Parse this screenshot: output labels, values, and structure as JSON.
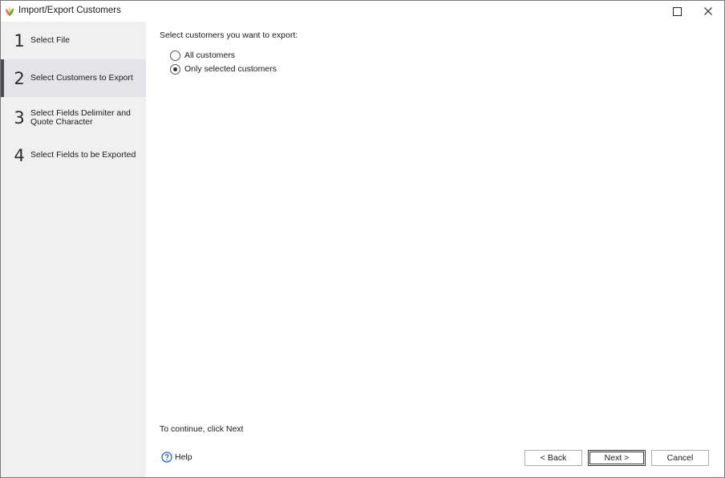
{
  "window": {
    "title": "Import/Export Customers",
    "maximize_icon": "maximize-icon",
    "close_icon": "close-icon"
  },
  "steps": [
    {
      "number": "1",
      "label": "Select File",
      "active": false
    },
    {
      "number": "2",
      "label": "Select Customers to Export",
      "active": true
    },
    {
      "number": "3",
      "label": "Select Fields Delimiter and Quote Character",
      "active": false
    },
    {
      "number": "4",
      "label": "Select Fields to be Exported",
      "active": false
    }
  ],
  "content": {
    "prompt": "Select customers you want to export:",
    "options": [
      {
        "label": "All customers",
        "checked": false
      },
      {
        "label": "Only selected customers",
        "checked": true
      }
    ],
    "continue_text": "To continue, click Next"
  },
  "footer": {
    "help_label": "Help",
    "back_label": "< Back",
    "next_label": "Next >",
    "cancel_label": "Cancel"
  },
  "colors": {
    "sidebar_bg": "#f0f0f0",
    "active_step_bg": "#e4e4e8",
    "help_icon": "#1e6fc8"
  }
}
